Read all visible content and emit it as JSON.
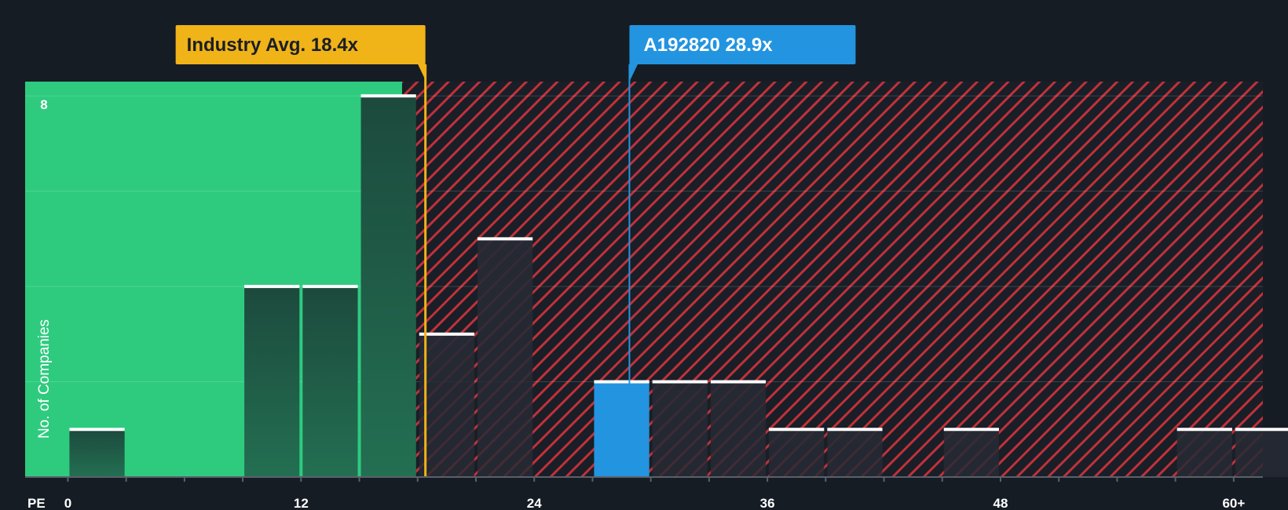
{
  "chart_data": {
    "type": "bar",
    "x_axis_label": "PE",
    "y_axis_label": "No. of Companies",
    "x_ticks": [
      "0",
      "12",
      "24",
      "36",
      "48",
      "60+"
    ],
    "y_tick_labels": [
      "8"
    ],
    "bin_width": 3,
    "x_range": [
      -2.2,
      61.5
    ],
    "y_range": [
      0,
      8.3
    ],
    "bins": [
      {
        "start": 0,
        "count": 1
      },
      {
        "start": 9,
        "count": 4
      },
      {
        "start": 12,
        "count": 4
      },
      {
        "start": 15,
        "count": 8
      },
      {
        "start": 18,
        "count": 3
      },
      {
        "start": 21,
        "count": 5
      },
      {
        "start": 27,
        "count": 2,
        "highlight": true
      },
      {
        "start": 30,
        "count": 2
      },
      {
        "start": 33,
        "count": 2
      },
      {
        "start": 36,
        "count": 1
      },
      {
        "start": 39,
        "count": 1
      },
      {
        "start": 45,
        "count": 1
      },
      {
        "start": 57,
        "count": 1
      },
      {
        "start": 60,
        "count": 1
      }
    ],
    "fair_zone_max": 17.2,
    "industry_avg": {
      "label": "Industry Avg. 18.4x",
      "value": 18.4
    },
    "company": {
      "label": "A192820 28.9x",
      "value": 28.9
    },
    "colors": {
      "background": "#161c24",
      "undervalued": "#2ecb7f",
      "overvalued_hatch": "#c0313b",
      "bar_dark": "#1d4a3d",
      "bar_over": "#2a2a33",
      "highlight": "#2394e0",
      "industry": "#f0b318"
    }
  }
}
